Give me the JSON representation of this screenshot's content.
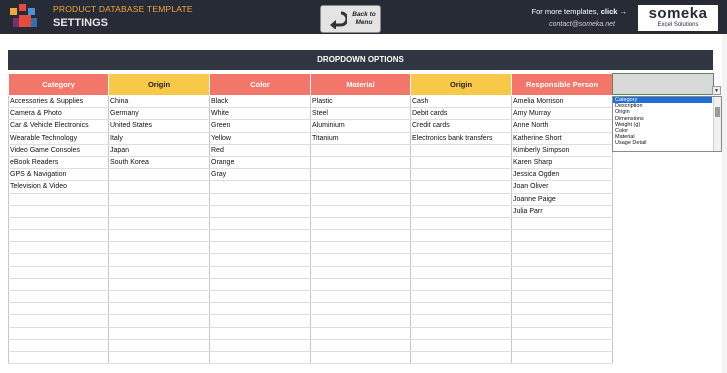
{
  "header": {
    "subtitle": "PRODUCT DATABASE TEMPLATE",
    "title": "SETTINGS",
    "back_button": "Back to Menu",
    "promo_prefix": "For more templates,",
    "promo_link": "click →",
    "contact": "contact@someka.net",
    "brand_name": "someka",
    "brand_tag": "Excel Solutions"
  },
  "banner": {
    "title": "DROPDOWN OPTIONS"
  },
  "table": {
    "headers": [
      "Category",
      "Origin",
      "Color",
      "Material",
      "Origin",
      "Responsible Person"
    ],
    "header_colors": [
      "red",
      "yellow",
      "red",
      "red",
      "yellow",
      "red"
    ],
    "rows": [
      [
        "Accessories & Supplies",
        "China",
        "Black",
        "Plastic",
        "Cash",
        "Amelia Morrison"
      ],
      [
        "Camera & Photo",
        "Germany",
        "White",
        "Steel",
        "Debit cards",
        "Amy Murray"
      ],
      [
        "Car & Vehicle Electronics",
        "United States",
        "Green",
        "Aluminium",
        "Credit cards",
        "Anne North"
      ],
      [
        "Wearable Technology",
        "Italy",
        "Yellow",
        "Titanium",
        "Electronics bank transfers",
        "Katherine Short"
      ],
      [
        "Video Game Consoles",
        "Japan",
        "Red",
        "",
        "",
        "Kimberly Simpson"
      ],
      [
        "eBook Readers",
        "South Korea",
        "Orange",
        "",
        "",
        "Karen Sharp"
      ],
      [
        "GPS & Navigation",
        "",
        "Gray",
        "",
        "",
        "Jessica Ogden"
      ],
      [
        "Television & Video",
        "",
        "",
        "",
        "",
        "Joan Oliver"
      ],
      [
        "",
        "",
        "",
        "",
        "",
        "Joanne Paige"
      ],
      [
        "",
        "",
        "",
        "",
        "",
        "Julia Parr"
      ],
      [
        "",
        "",
        "",
        "",
        "",
        ""
      ],
      [
        "",
        "",
        "",
        "",
        "",
        ""
      ],
      [
        "",
        "",
        "",
        "",
        "",
        ""
      ],
      [
        "",
        "",
        "",
        "",
        "",
        ""
      ],
      [
        "",
        "",
        "",
        "",
        "",
        ""
      ],
      [
        "",
        "",
        "",
        "",
        "",
        ""
      ],
      [
        "",
        "",
        "",
        "",
        "",
        ""
      ],
      [
        "",
        "",
        "",
        "",
        "",
        ""
      ],
      [
        "",
        "",
        "",
        "",
        "",
        ""
      ],
      [
        "",
        "",
        "",
        "",
        "",
        ""
      ],
      [
        "",
        "",
        "",
        "",
        "",
        ""
      ],
      [
        "",
        "",
        "",
        "",
        "",
        ""
      ]
    ]
  },
  "dropdown": {
    "selected": "Category",
    "options": [
      "Category",
      "Description",
      "Origin",
      "Dimensions",
      "Weight (g)",
      "Color",
      "Material",
      "Usage Detail"
    ]
  },
  "colors": {
    "header_bg": "#262b35",
    "accent_orange": "#f3a83b",
    "header_red": "#f3766b",
    "header_yellow": "#f8c948",
    "banner_bg": "#2f3541"
  }
}
